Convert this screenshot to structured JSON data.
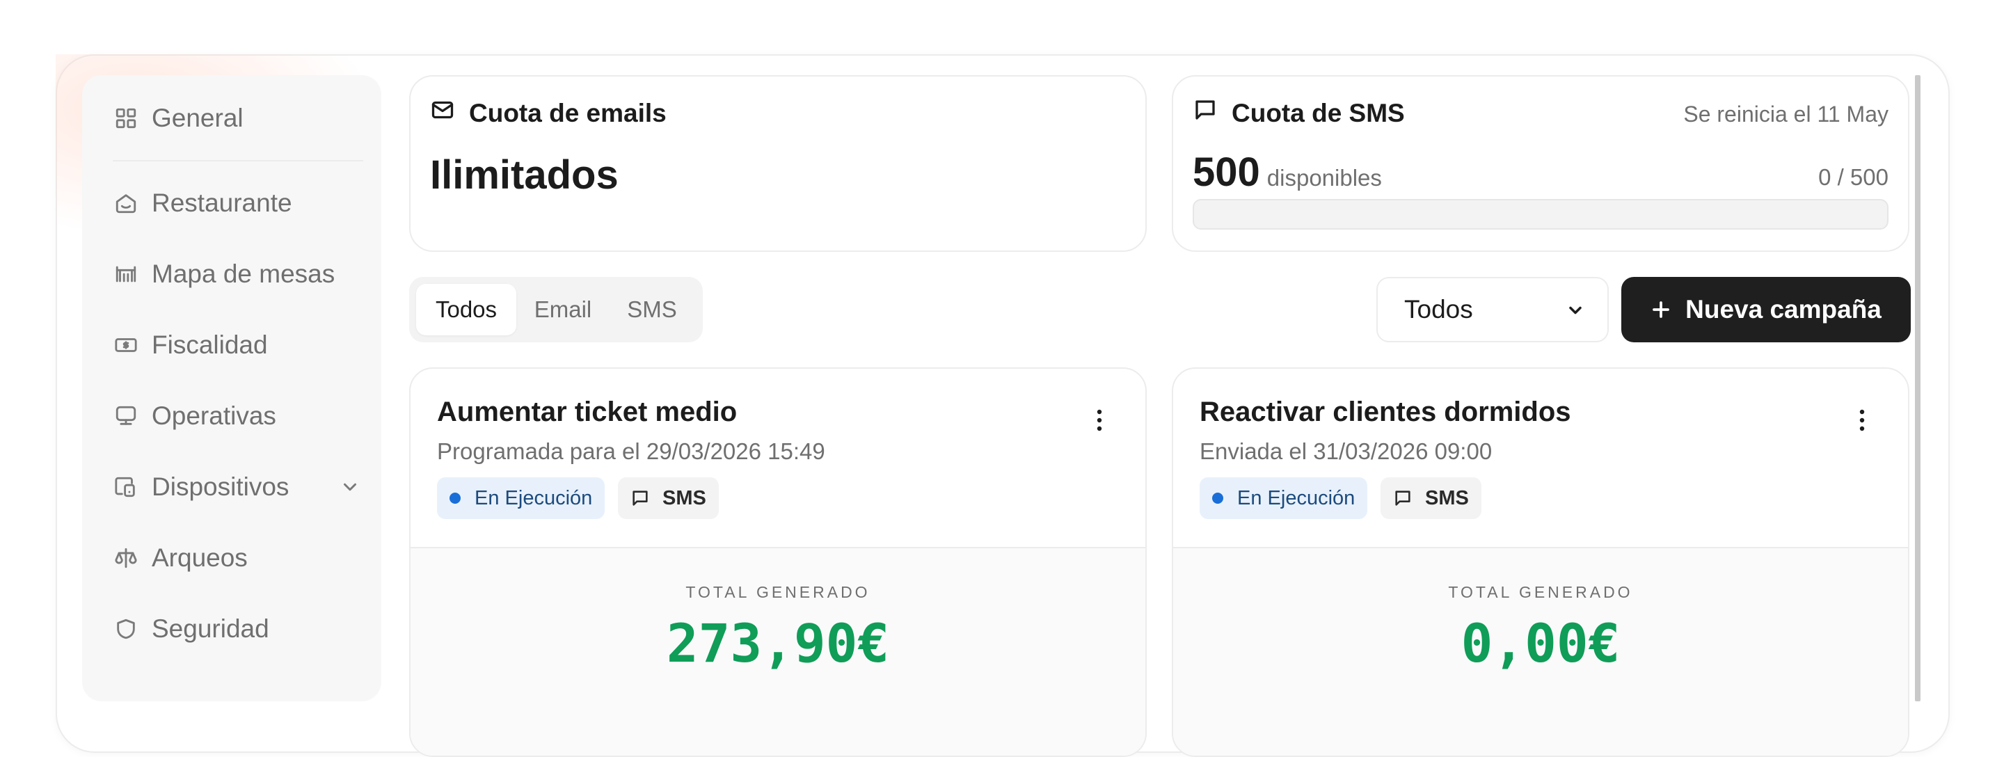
{
  "sidebar": {
    "items": [
      {
        "label": "General",
        "icon": "grid-icon"
      },
      {
        "label": "Restaurante",
        "icon": "home-icon"
      },
      {
        "label": "Mapa de mesas",
        "icon": "table-icon"
      },
      {
        "label": "Fiscalidad",
        "icon": "banknote-icon"
      },
      {
        "label": "Operativas",
        "icon": "monitor-icon"
      },
      {
        "label": "Dispositivos",
        "icon": "devices-icon"
      },
      {
        "label": "Arqueos",
        "icon": "scale-icon"
      },
      {
        "label": "Seguridad",
        "icon": "shield-icon"
      }
    ]
  },
  "email_quota": {
    "title": "Cuota de emails",
    "value": "Ilimitados"
  },
  "sms_quota": {
    "title": "Cuota de SMS",
    "reset_text": "Se reinicia el 11 May",
    "available": "500",
    "available_label": "disponibles",
    "usage_text": "0 / 500",
    "usage_fraction": 0
  },
  "filters": {
    "tabs": [
      {
        "label": "Todos",
        "active": true
      },
      {
        "label": "Email",
        "active": false
      },
      {
        "label": "SMS",
        "active": false
      }
    ],
    "select_value": "Todos",
    "new_button": "Nueva campaña"
  },
  "campaigns": [
    {
      "title": "Aumentar ticket medio",
      "subtitle": "Programada para el 29/03/2026 15:49",
      "status": "En Ejecución",
      "channel": "SMS",
      "total_label": "TOTAL GENERADO",
      "total_value": "273,90€"
    },
    {
      "title": "Reactivar clientes dormidos",
      "subtitle": "Enviada el 31/03/2026 09:00",
      "status": "En Ejecución",
      "channel": "SMS",
      "total_label": "TOTAL GENERADO",
      "total_value": "0,00€"
    }
  ],
  "colors": {
    "accent_dark": "#1f1f1f",
    "status_blue": "#1a6ed8",
    "money_green": "#0f9d58"
  }
}
